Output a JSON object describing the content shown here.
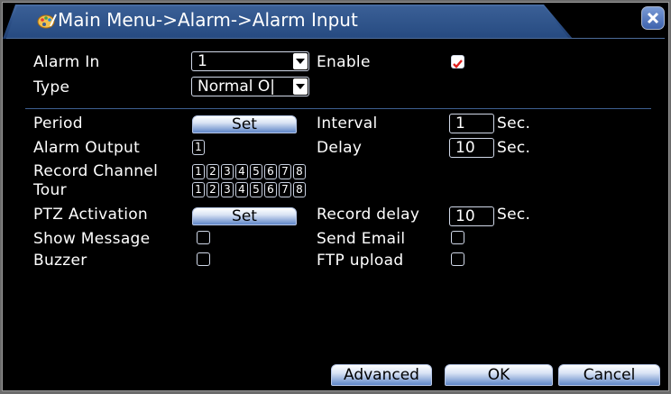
{
  "window": {
    "title": "Main Menu->Alarm->Alarm Input"
  },
  "form": {
    "alarm_in_label": "Alarm In",
    "alarm_in_value": "1",
    "enable_label": "Enable",
    "enable_checked": true,
    "type_label": "Type",
    "type_value": "Normal O|",
    "period_label": "Period",
    "period_button": "Set",
    "interval_label": "Interval",
    "interval_value": "1",
    "interval_unit": "Sec.",
    "alarm_output_label": "Alarm Output",
    "alarm_output_channels": [
      "1"
    ],
    "delay_label": "Delay",
    "delay_value": "10",
    "delay_unit": "Sec.",
    "record_channel_label": "Record Channel",
    "record_channels": [
      "1",
      "2",
      "3",
      "4",
      "5",
      "6",
      "7",
      "8"
    ],
    "tour_label": "Tour",
    "tour_channels": [
      "1",
      "2",
      "3",
      "4",
      "5",
      "6",
      "7",
      "8"
    ],
    "ptz_label": "PTZ Activation",
    "ptz_button": "Set",
    "record_delay_label": "Record delay",
    "record_delay_value": "10",
    "record_delay_unit": "Sec.",
    "show_message_label": "Show Message",
    "show_message_checked": false,
    "send_email_label": "Send Email",
    "send_email_checked": false,
    "buzzer_label": "Buzzer",
    "buzzer_checked": false,
    "ftp_upload_label": "FTP upload",
    "ftp_upload_checked": false
  },
  "footer": {
    "advanced_label": "Advanced",
    "ok_label": "OK",
    "cancel_label": "Cancel"
  },
  "colors": {
    "title_bar": "#2b4f86",
    "background": "#000000",
    "check_mark": "#e0201e",
    "button_gradient_bottom": "#5f86c8"
  },
  "icons": {
    "title_icon": "palette-icon",
    "close": "close-icon",
    "dropdown": "chevron-down-icon"
  }
}
